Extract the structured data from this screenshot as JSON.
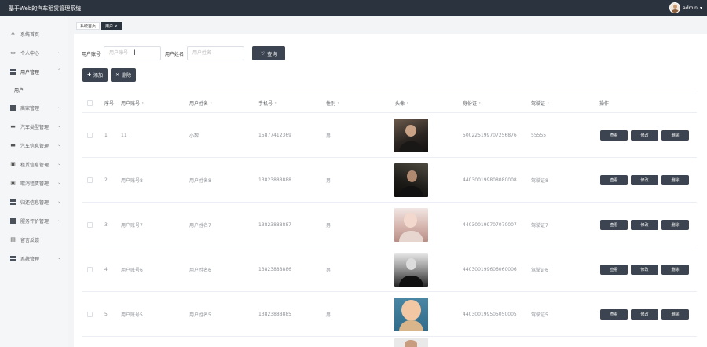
{
  "header": {
    "title": "基于Web的汽车租赁管理系统",
    "username": "admin"
  },
  "sidebar": {
    "items": [
      {
        "label": "系统首页",
        "icon": "home-icon"
      },
      {
        "label": "个人中心",
        "icon": "calendar-icon"
      },
      {
        "label": "用户管理",
        "icon": "grid-icon"
      },
      {
        "label": "用户",
        "icon": ""
      },
      {
        "label": "商家管理",
        "icon": "grid-icon"
      },
      {
        "label": "汽车类型管理",
        "icon": "car-icon"
      },
      {
        "label": "汽车信息管理",
        "icon": "car-icon"
      },
      {
        "label": "租赁信息管理",
        "icon": "box-icon"
      },
      {
        "label": "取消租赁管理",
        "icon": "box-icon"
      },
      {
        "label": "归还信息管理",
        "icon": "grid-icon"
      },
      {
        "label": "服务评价管理",
        "icon": "grid-icon"
      },
      {
        "label": "留言反馈",
        "icon": "message-icon"
      },
      {
        "label": "系统管理",
        "icon": "grid-icon"
      }
    ]
  },
  "tabs": [
    {
      "label": "系统首页"
    },
    {
      "label": "用户 ×"
    }
  ],
  "search": {
    "account_label": "用户账号",
    "account_placeholder": "用户账号",
    "name_label": "用户姓名",
    "name_placeholder": "用户姓名",
    "query_label": "查询"
  },
  "actions": {
    "add_label": "添加",
    "delete_label": "删除"
  },
  "table": {
    "columns": [
      "序号",
      "用户账号",
      "用户姓名",
      "手机号",
      "性别",
      "头像",
      "身份证",
      "驾驶证",
      "操作"
    ],
    "rows": [
      {
        "index": "1",
        "account": "11",
        "name": "小黎",
        "phone": "15877412369",
        "gender": "男",
        "id_card": "500225199707256876",
        "license": "55555"
      },
      {
        "index": "2",
        "account": "用户账号8",
        "name": "用户姓名8",
        "phone": "13823888888",
        "gender": "男",
        "id_card": "440300199808080008",
        "license": "驾驶证8"
      },
      {
        "index": "3",
        "account": "用户账号7",
        "name": "用户姓名7",
        "phone": "13823888887",
        "gender": "男",
        "id_card": "440300199707070007",
        "license": "驾驶证7"
      },
      {
        "index": "4",
        "account": "用户账号6",
        "name": "用户姓名6",
        "phone": "13823888886",
        "gender": "男",
        "id_card": "440300199606060006",
        "license": "驾驶证6"
      },
      {
        "index": "5",
        "account": "用户账号5",
        "name": "用户姓名5",
        "phone": "13823888885",
        "gender": "男",
        "id_card": "440300199505050005",
        "license": "驾驶证5"
      }
    ],
    "row_actions": {
      "view": "查看",
      "edit": "修改",
      "delete": "删除"
    }
  }
}
